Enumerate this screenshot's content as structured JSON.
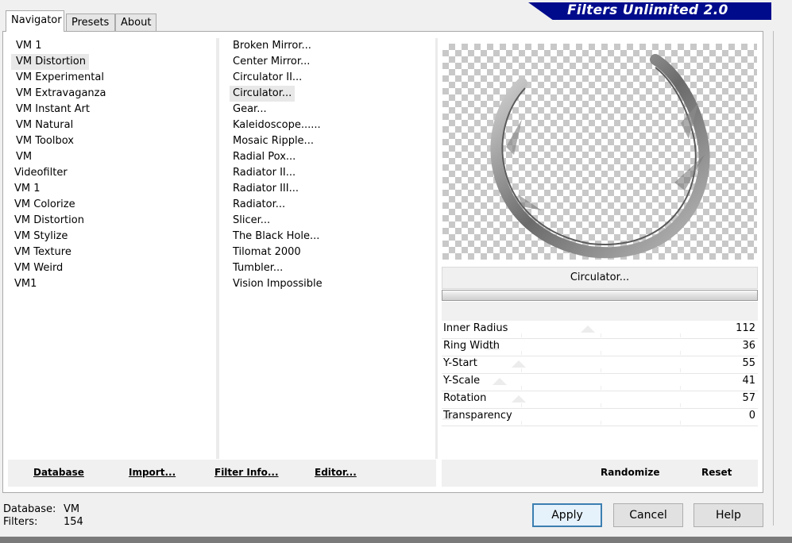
{
  "tabs": [
    "Navigator",
    "Presets",
    "About"
  ],
  "banner_title": "Filters Unlimited 2.0",
  "categories": [
    {
      "label": "VM 1",
      "selected": false
    },
    {
      "label": "VM Distortion",
      "selected": true
    },
    {
      "label": "VM Experimental",
      "selected": false
    },
    {
      "label": "VM Extravaganza",
      "selected": false
    },
    {
      "label": "VM Instant Art",
      "selected": false
    },
    {
      "label": "VM Natural",
      "selected": false
    },
    {
      "label": "VM Toolbox",
      "selected": false
    },
    {
      "label": "VM",
      "selected": false
    },
    {
      "label": "Videofilter",
      "selected": false
    },
    {
      "label": "VM 1",
      "selected": false
    },
    {
      "label": "VM Colorize",
      "selected": false
    },
    {
      "label": "VM Distortion",
      "selected": false
    },
    {
      "label": "VM Stylize",
      "selected": false
    },
    {
      "label": "VM Texture",
      "selected": false
    },
    {
      "label": "VM Weird",
      "selected": false
    },
    {
      "label": "VM1",
      "selected": false
    }
  ],
  "filters": [
    {
      "label": "Broken Mirror...",
      "selected": false
    },
    {
      "label": "Center Mirror...",
      "selected": false
    },
    {
      "label": "Circulator II...",
      "selected": false
    },
    {
      "label": "Circulator...",
      "selected": true
    },
    {
      "label": "Gear...",
      "selected": false
    },
    {
      "label": "Kaleidoscope......",
      "selected": false
    },
    {
      "label": "Mosaic Ripple...",
      "selected": false
    },
    {
      "label": "Radial Pox...",
      "selected": false
    },
    {
      "label": "Radiator II...",
      "selected": false
    },
    {
      "label": "Radiator III...",
      "selected": false
    },
    {
      "label": "Radiator...",
      "selected": false
    },
    {
      "label": "Slicer...",
      "selected": false
    },
    {
      "label": "The Black Hole...",
      "selected": false
    },
    {
      "label": "Tilomat 2000",
      "selected": false
    },
    {
      "label": "Tumbler...",
      "selected": false
    },
    {
      "label": "Vision Impossible",
      "selected": false
    }
  ],
  "preview": {
    "filter_name": "Circulator..."
  },
  "params": [
    {
      "name": "Inner Radius",
      "value": "112",
      "level": 0.44
    },
    {
      "name": "Ring Width",
      "value": "36",
      "level": 0.14
    },
    {
      "name": "Y-Start",
      "value": "55",
      "level": 0.22
    },
    {
      "name": "Y-Scale",
      "value": "41",
      "level": 0.16
    },
    {
      "name": "Rotation",
      "value": "57",
      "level": 0.22
    },
    {
      "name": "Transparency",
      "value": "0",
      "level": 0.0
    }
  ],
  "left_buttons": {
    "database": "Database",
    "import": "Import...",
    "filter_info": "Filter Info...",
    "editor": "Editor..."
  },
  "right_buttons": {
    "randomize": "Randomize",
    "reset": "Reset"
  },
  "status": {
    "database_label": "Database:",
    "database_value": "VM",
    "filters_label": "Filters:",
    "filters_value": "154"
  },
  "dialog_buttons": {
    "apply": "Apply",
    "cancel": "Cancel",
    "help": "Help"
  }
}
